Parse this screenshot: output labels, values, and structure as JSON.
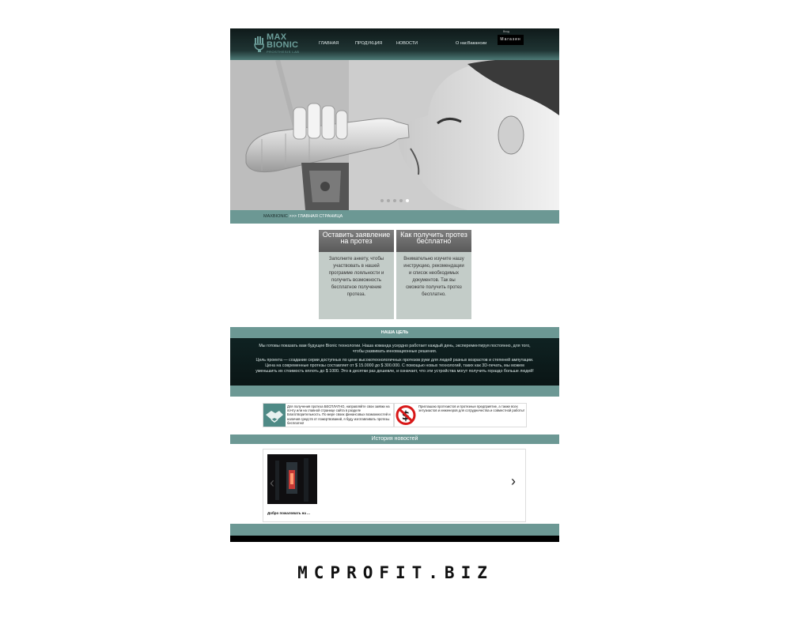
{
  "logo": {
    "line1": "MAX",
    "line2": "BIONIC",
    "sub": "PROSTHESIS LAB"
  },
  "nav": {
    "home": "ГЛАВНАЯ",
    "products": "ПРОДУКЦИЯ",
    "news": "НОВОСТИ",
    "about": "О нас",
    "vacancies": "Вакансии",
    "enter": "Вход",
    "shop": "Магазин"
  },
  "breadcrumb": {
    "root": "MAXBIONIC",
    "sep": " >>> ",
    "current": "ГЛАВНАЯ СТРАНИЦА"
  },
  "cards": [
    {
      "title": "Оставить заявление на протез",
      "text": "Заполните анкету, чтобы участвовать в нашей программе лояльности и получить возможность бесплатное получение протеза."
    },
    {
      "title": "Как получить протез бесплатно",
      "text": "Внимательно изучите нашу инструкцию, рекомендации и список необходимых документов. Так вы сможете получить протез бесплатно."
    }
  ],
  "goal": {
    "title": "НАША ЦЕЛЬ",
    "p1": "Мы готовы показать вам будущее Bionic технологии. Наша команда усердно работает каждый день, эксперементируя постоянно, для того, чтобы развивать инновационные решения.",
    "p2": "Цель проекта — создание серии доступных по цене высокотехнологичных протезов руки для людей разных возрастов и степеней ампутации. Цена на современные протезы составляет от $ 15.0000 до $ 300.000. С помощью новых технологий, таких как 3D-печать, мы можем уменьшить их стоимость вплоть до $ 1000. Это в десятки раз дешевле, и означает, что эти устройства могут получить гораздо больше людей!"
  },
  "info": [
    {
      "icon": "handshake-icon",
      "text": "Для получения протеза БЕСПЛАТНО, направляйте свои заявки на почту или на главной странице сайта в разделе Благотворительность. По мере своих финансовых возможностей и наличия средств от пожертвований, я буду изготавливать протезы бесплатно!"
    },
    {
      "icon": "no-money-icon",
      "text": "Приглашаю протезистов и протезные предприятие, а также всех энтузиастов и инженеров для сотрудничества и совместной работы!"
    }
  ],
  "news": {
    "title": "История новостей",
    "caption": "Добро пожаловать на ..."
  },
  "slider": {
    "dots": 5,
    "active": 5
  },
  "watermark": "MCPROFIT.BIZ",
  "colors": {
    "teal": "#6c9894",
    "dark": "#0f2222",
    "logo": "#6c9e9a"
  }
}
